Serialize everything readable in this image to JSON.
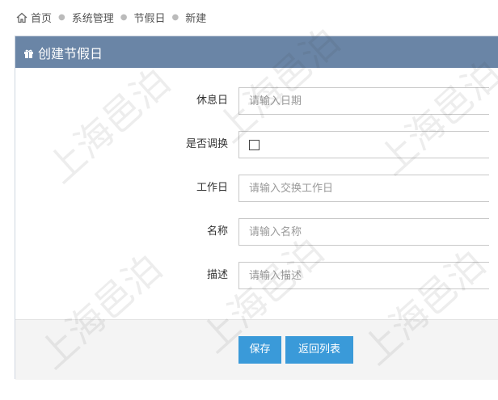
{
  "breadcrumb": {
    "items": [
      "首页",
      "系统管理",
      "节假日",
      "新建"
    ]
  },
  "panel": {
    "title": "创建节假日"
  },
  "form": {
    "rest_day": {
      "label": "休息日",
      "placeholder": "请输入日期",
      "value": ""
    },
    "is_swap": {
      "label": "是否调换",
      "checked": false
    },
    "work_day": {
      "label": "工作日",
      "placeholder": "请输入交换工作日",
      "value": ""
    },
    "name": {
      "label": "名称",
      "placeholder": "请输入名称",
      "value": ""
    },
    "description": {
      "label": "描述",
      "placeholder": "请输入描述",
      "value": ""
    }
  },
  "actions": {
    "save_label": "保存",
    "back_label": "返回列表"
  },
  "watermark": {
    "text": "上海邑泊"
  },
  "colors": {
    "header_bg": "#6a85a6",
    "button_bg": "#3a9ad9",
    "footer_bg": "#f4f4f4"
  },
  "icons": {
    "home": "home-icon",
    "header": "gift-icon"
  }
}
